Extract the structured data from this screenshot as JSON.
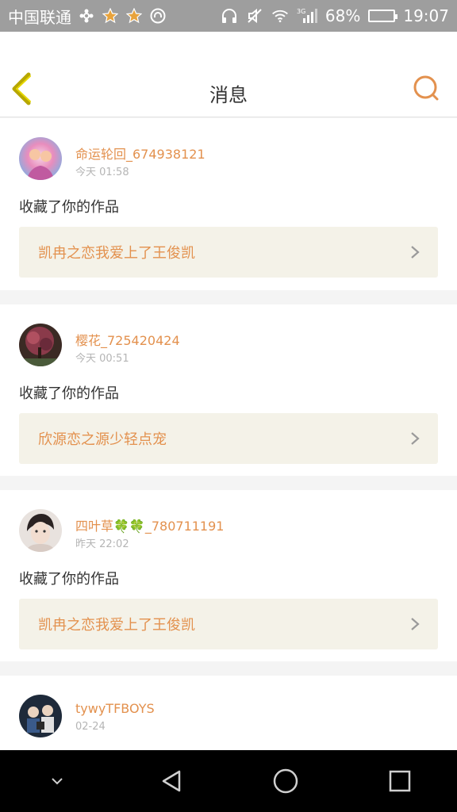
{
  "status_bar": {
    "carrier": "中国联通",
    "battery_percent": "68%",
    "battery_level": 0.68,
    "time": "19:07",
    "network": "3G"
  },
  "header": {
    "title": "消息"
  },
  "messages": [
    {
      "user": "命运轮回_674938121",
      "time": "今天 01:58",
      "action": "收藏了你的作品",
      "work": "凯冉之恋我爱上了王俊凯",
      "avatar_color": "#8ab4e8"
    },
    {
      "user": "樱花_725420424",
      "time": "今天 00:51",
      "action": "收藏了你的作品",
      "work": "欣源恋之源少轻点宠",
      "avatar_color": "#5a3a3a"
    },
    {
      "user": "四叶草🍀🍀_780711191",
      "time": "昨天 22:02",
      "action": "收藏了你的作品",
      "work": "凯冉之恋我爱上了王俊凯",
      "avatar_color": "#c9b8b0"
    },
    {
      "user": "tywyTFBOYS",
      "time": "02-24",
      "avatar_color": "#2c3e50"
    }
  ],
  "colors": {
    "accent": "#e3914e",
    "back_arrow": "#c8b400"
  }
}
